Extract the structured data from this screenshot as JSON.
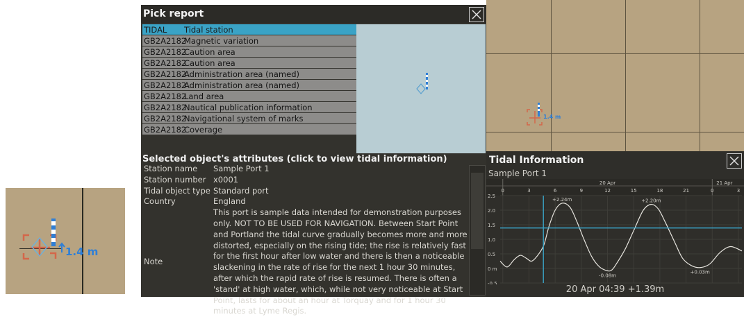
{
  "inset": {
    "depth_label": "1.4 m"
  },
  "pick": {
    "title": "Pick report",
    "rows": [
      {
        "code": "TIDAL",
        "name": "Tidal station",
        "selected": true
      },
      {
        "code": "GB2A2182",
        "name": "Magnetic variation"
      },
      {
        "code": "GB2A2182",
        "name": "Caution area"
      },
      {
        "code": "GB2A2182",
        "name": "Caution area"
      },
      {
        "code": "GB2A2182",
        "name": "Administration area (named)"
      },
      {
        "code": "GB2A2182",
        "name": "Administration area (named)"
      },
      {
        "code": "GB2A2182",
        "name": "Land area"
      },
      {
        "code": "GB2A2182",
        "name": "Nautical publication information"
      },
      {
        "code": "GB2A2182",
        "name": "Navigational system of marks"
      },
      {
        "code": "GB2A2182",
        "name": "Coverage"
      }
    ],
    "attributes_title": "Selected object's attributes (click to view tidal information)",
    "attributes": [
      {
        "key": "Station name",
        "value": "Sample Port 1"
      },
      {
        "key": "Station number",
        "value": "x0001"
      },
      {
        "key": "Tidal object type",
        "value": "Standard port"
      },
      {
        "key": "Country",
        "value": "England"
      },
      {
        "key": "Note",
        "value": "This port is sample data intended for demonstration purposes only. NOT TO BE USED FOR NAVIGATION. Between Start Point and Portland the tidal curve gradually becomes more and more distorted, especially on the rising tide; the rise is relatively fast for the first hour after low water and there is then a noticeable slackening in the rate of rise for the next 1 hour 30 minutes, after which the rapid rate of rise is resumed. There is often a 'stand' at high water, which, while not very noticeable at Start Point, lasts for about an hour at Torquay and for 1 hour 30 minutes at Lyme Regis."
      }
    ]
  },
  "map": {
    "depth_label": "1.4 m"
  },
  "tidal": {
    "title": "Tidal Information",
    "station": "Sample Port 1",
    "readout": "20 Apr 04:39 +1.39m"
  },
  "chart_data": {
    "type": "line",
    "title": "",
    "date_labels": [
      "20 Apr",
      "21 Apr"
    ],
    "x_ticks": [
      0,
      3,
      6,
      9,
      12,
      15,
      18,
      21,
      0,
      3
    ],
    "xlim": [
      -0.3,
      27.4
    ],
    "y_ticks": [
      "2.5",
      "2.0",
      "1.5",
      "1.0",
      "0.5",
      "0 m",
      "-0.5"
    ],
    "ylim": [
      -0.5,
      2.5
    ],
    "series": [
      {
        "x": [
          -0.3,
          0.5,
          1.3,
          2.0,
          2.7,
          3.3,
          4.0,
          4.7,
          5.3,
          6.0,
          6.8,
          7.7,
          8.5,
          9.3,
          10.2,
          11.1,
          12.0,
          12.5,
          13.0,
          14.0,
          15.0,
          16.1,
          17.0,
          17.8,
          18.6,
          19.7,
          20.6,
          21.6,
          22.6,
          23.7,
          24.9,
          26.1,
          27.4
        ],
        "y": [
          0.25,
          0.05,
          0.3,
          0.45,
          0.35,
          0.25,
          0.45,
          0.8,
          1.45,
          2.0,
          2.24,
          2.1,
          1.6,
          1.0,
          0.4,
          0.05,
          -0.08,
          -0.05,
          0.15,
          0.65,
          1.3,
          2.0,
          2.2,
          2.05,
          1.6,
          0.9,
          0.35,
          0.1,
          0.03,
          0.15,
          0.55,
          0.75,
          0.6
        ]
      }
    ],
    "annotations": [
      {
        "x": 6.8,
        "y": 2.24,
        "text": "+2.24m"
      },
      {
        "x": 12.0,
        "y": -0.08,
        "text": "-0.08m"
      },
      {
        "x": 17.0,
        "y": 2.2,
        "text": "+2.20m"
      },
      {
        "x": 22.6,
        "y": 0.03,
        "text": "+0.03m"
      }
    ],
    "cursor": {
      "x": 4.65,
      "y": 1.39
    },
    "grid": true,
    "colors": {
      "line": "#e6e4de",
      "cursor": "#3aa3c6"
    }
  }
}
